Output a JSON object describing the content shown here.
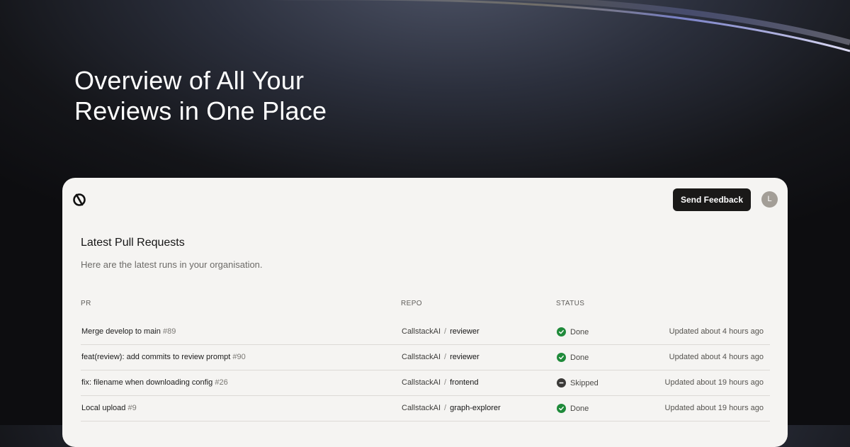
{
  "hero": {
    "line1": "Overview of All Your",
    "line2": "Reviews in One Place"
  },
  "header": {
    "feedback_label": "Send Feedback",
    "avatar_initial": "L"
  },
  "section": {
    "title": "Latest Pull Requests",
    "subtitle": "Here are the latest runs in your organisation."
  },
  "table": {
    "columns": {
      "pr": "PR",
      "repo": "REPO",
      "status": "STATUS"
    },
    "rows": [
      {
        "title": "Merge develop to main",
        "number": "#89",
        "org": "CallstackAI",
        "sep": "/",
        "repo": "reviewer",
        "status": "Done",
        "status_kind": "done",
        "updated": "Updated about 4 hours ago"
      },
      {
        "title": "feat(review): add commits to review prompt",
        "number": "#90",
        "org": "CallstackAI",
        "sep": "/",
        "repo": "reviewer",
        "status": "Done",
        "status_kind": "done",
        "updated": "Updated about 4 hours ago"
      },
      {
        "title": "fix: filename when downloading config",
        "number": "#26",
        "org": "CallstackAI",
        "sep": "/",
        "repo": "frontend",
        "status": "Skipped",
        "status_kind": "skipped",
        "updated": "Updated about 19 hours ago"
      },
      {
        "title": "Local upload",
        "number": "#9",
        "org": "CallstackAI",
        "sep": "/",
        "repo": "graph-explorer",
        "status": "Done",
        "status_kind": "done",
        "updated": "Updated about 19 hours ago"
      }
    ]
  },
  "colors": {
    "done": "#1f8a3a",
    "skipped": "#3b3a38",
    "button_bg": "#1a1918",
    "card_bg": "#f5f4f2"
  }
}
